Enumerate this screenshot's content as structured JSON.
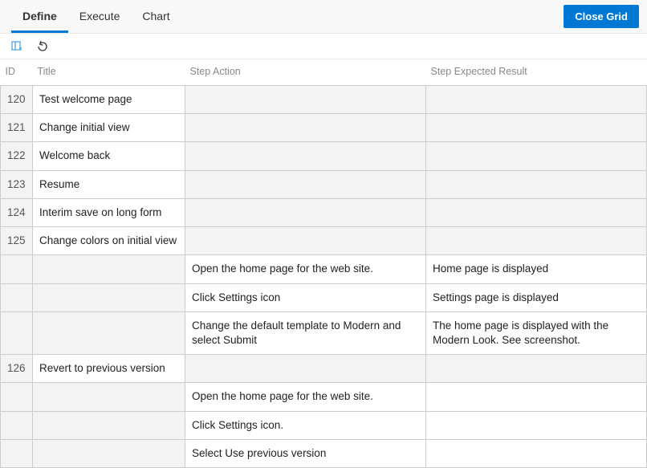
{
  "tabs": {
    "define": "Define",
    "execute": "Execute",
    "chart": "Chart",
    "active": "define"
  },
  "close_button": "Close Grid",
  "columns": {
    "id": "ID",
    "title": "Title",
    "action": "Step Action",
    "expected": "Step Expected Result"
  },
  "rows": [
    {
      "kind": "title",
      "id": "120",
      "title": "Test welcome page"
    },
    {
      "kind": "title",
      "id": "121",
      "title": "Change initial view"
    },
    {
      "kind": "title",
      "id": "122",
      "title": "Welcome back"
    },
    {
      "kind": "title",
      "id": "123",
      "title": "Resume"
    },
    {
      "kind": "title",
      "id": "124",
      "title": "Interim save on long form"
    },
    {
      "kind": "title",
      "id": "125",
      "title": "Change colors on initial view"
    },
    {
      "kind": "step",
      "action": "Open the home page for the web site.",
      "expected": "Home page is displayed"
    },
    {
      "kind": "step",
      "action": "Click Settings icon",
      "expected": "Settings page is displayed"
    },
    {
      "kind": "step",
      "action": "Change the default template to Modern and select Submit",
      "expected": "The home page is displayed with the Modern Look. See screenshot."
    },
    {
      "kind": "title",
      "id": "126",
      "title": "Revert to previous version"
    },
    {
      "kind": "step",
      "action": "Open the home page for the web site.",
      "expected": ""
    },
    {
      "kind": "step",
      "action": "Click Settings icon.",
      "expected": ""
    },
    {
      "kind": "step",
      "action": "Select Use previous version",
      "expected": ""
    }
  ]
}
